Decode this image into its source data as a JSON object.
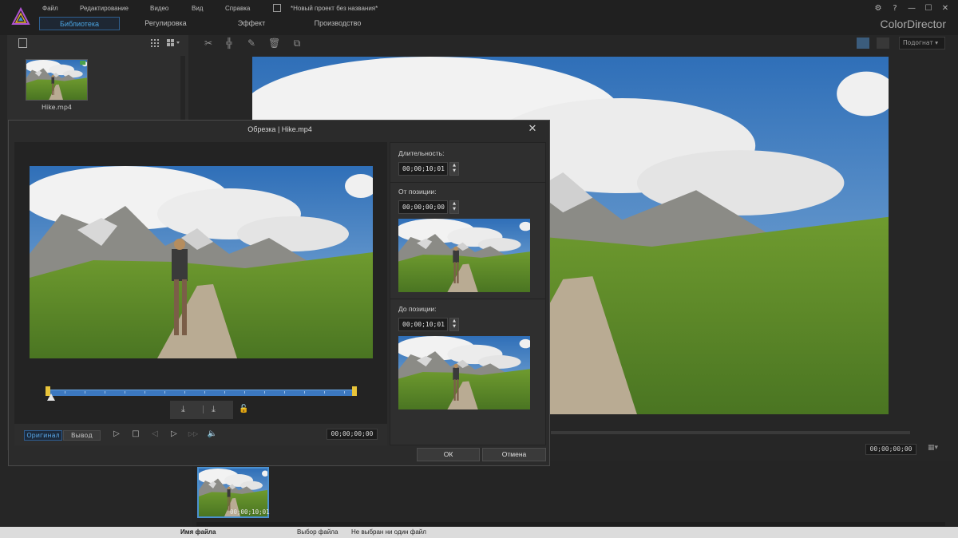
{
  "menu": {
    "file": "Файл",
    "edit": "Редактирование",
    "video": "Видео",
    "view": "Вид",
    "help": "Справка",
    "project_title": "*Новый проект без названия*"
  },
  "mode_tabs": {
    "library": "Библиотека",
    "adjust": "Регулировка",
    "effect": "Эффект",
    "produce": "Производство"
  },
  "window_controls": {
    "settings": "⚙",
    "help": "?",
    "minimize": "—",
    "maximize": "☐",
    "close": "✕"
  },
  "brand": "ColorDirector",
  "library": {
    "clip_name": "Hike.mp4"
  },
  "editor": {
    "fit_label": "Подогнат",
    "timecode": "00;00;00;00",
    "ratio_btn": "▦▾"
  },
  "timeline": {
    "clip_timecode": "00;00;10;01"
  },
  "bottom_strip": {
    "col1": "Имя файла",
    "col2": "Выбор файла",
    "col3": "Не выбран ни один файл"
  },
  "dialog": {
    "title": "Обрезка | Hike.mp4",
    "close": "✕",
    "duration_label": "Длительность:",
    "duration_value": "00;00;10;01",
    "from_label": "От позиции:",
    "from_value": "00;00;00;00",
    "to_label": "До позиции:",
    "to_value": "00;00;10;01",
    "original_btn": "Оригинал",
    "output_btn": "Вывод",
    "timecode": "00;00;00;00",
    "ok": "ОК",
    "cancel": "Отмена",
    "spin_up": "▲",
    "spin_down": "▼",
    "mark_in": "⤓",
    "mark_out": "⤓",
    "lock": "🔓",
    "play": "▷",
    "stop": "□",
    "prev_frame": "◁",
    "next_frame": "▷",
    "fast_forward": "▷▷",
    "volume": "🔈"
  },
  "icons": {
    "logo": "colordirector-logo-icon",
    "cut": "scissors-icon",
    "split": "split-icon",
    "delete": "trash-icon",
    "crop": "crop-icon"
  },
  "colors": {
    "accent": "#4aa3e0",
    "trim_track": "#3c78c0",
    "trim_handle": "#e8c43a"
  }
}
